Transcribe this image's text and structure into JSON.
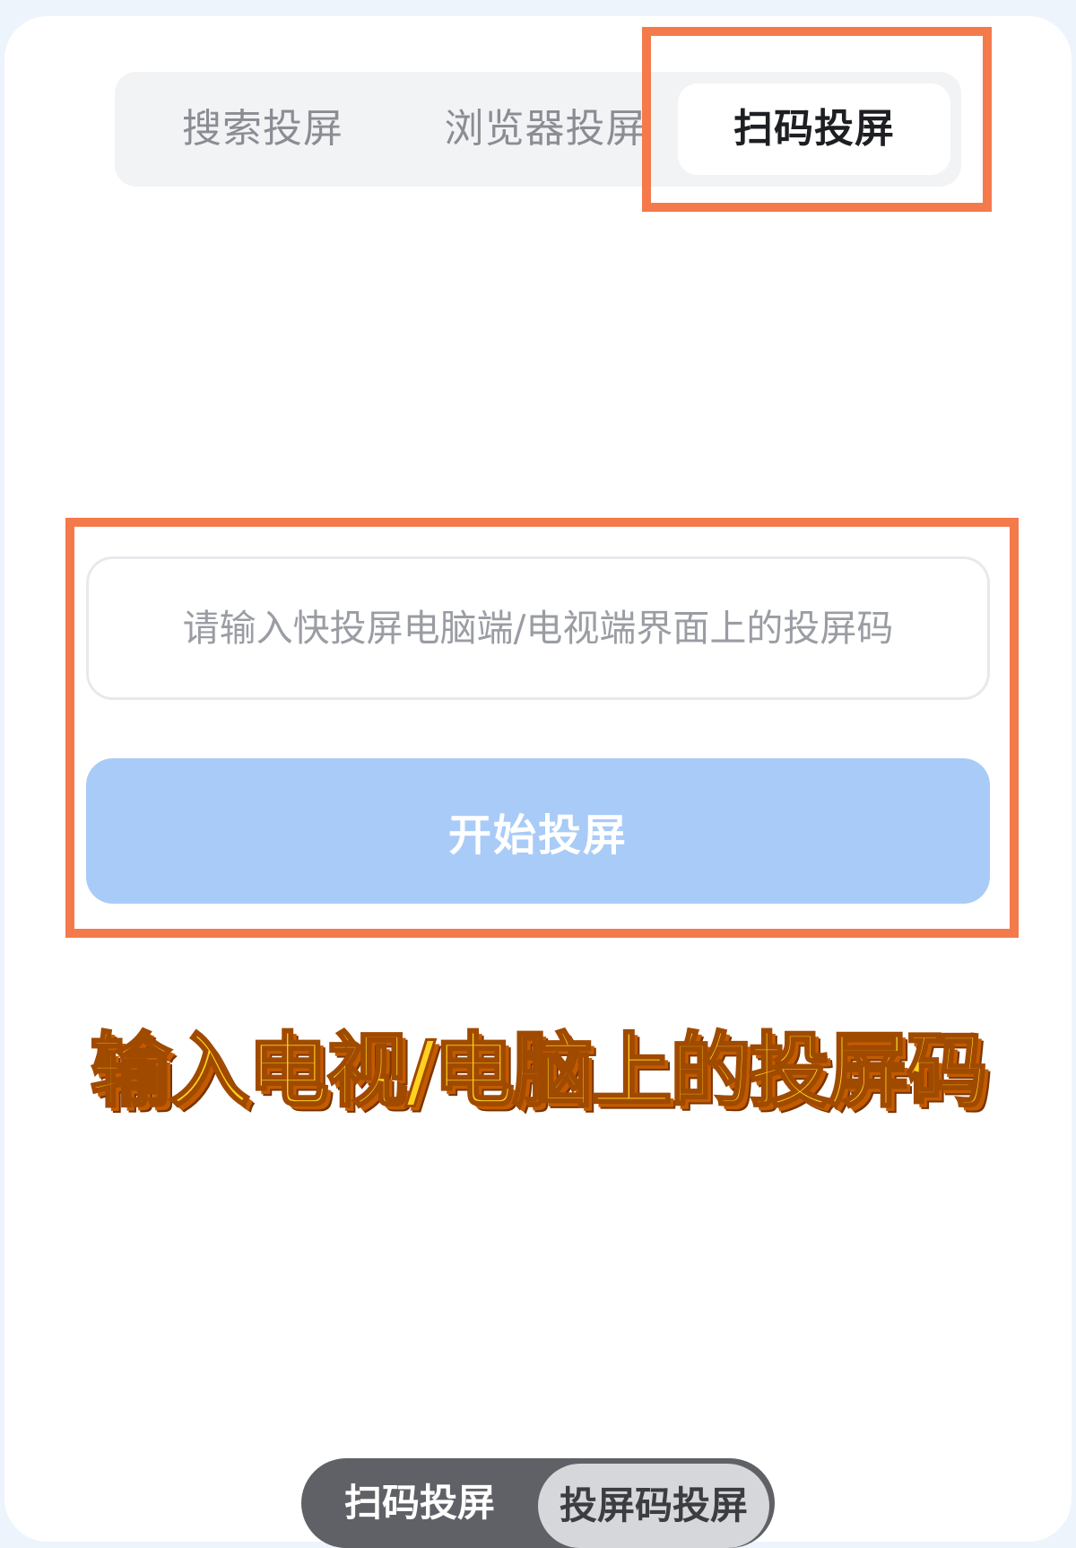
{
  "tabs": {
    "items": [
      {
        "label": "搜索投屏"
      },
      {
        "label": "浏览器投屏"
      },
      {
        "label": "扫码投屏"
      }
    ],
    "selected": "扫码投屏"
  },
  "form": {
    "code_input": {
      "placeholder": "请输入快投屏电脑端/电视端界面上的投屏码",
      "value": ""
    },
    "start_button_label": "开始投屏"
  },
  "caption": "输入电视/电脑上的投屏码",
  "bottom_toggle": {
    "items": [
      {
        "label": "扫码投屏"
      },
      {
        "label": "投屏码投屏"
      }
    ],
    "selected": "投屏码投屏"
  },
  "colors": {
    "highlight_border": "#f47a4c",
    "button_bg": "#a9cbf7",
    "caption_fill": "#ffd21f",
    "background": "#eef4fc"
  }
}
